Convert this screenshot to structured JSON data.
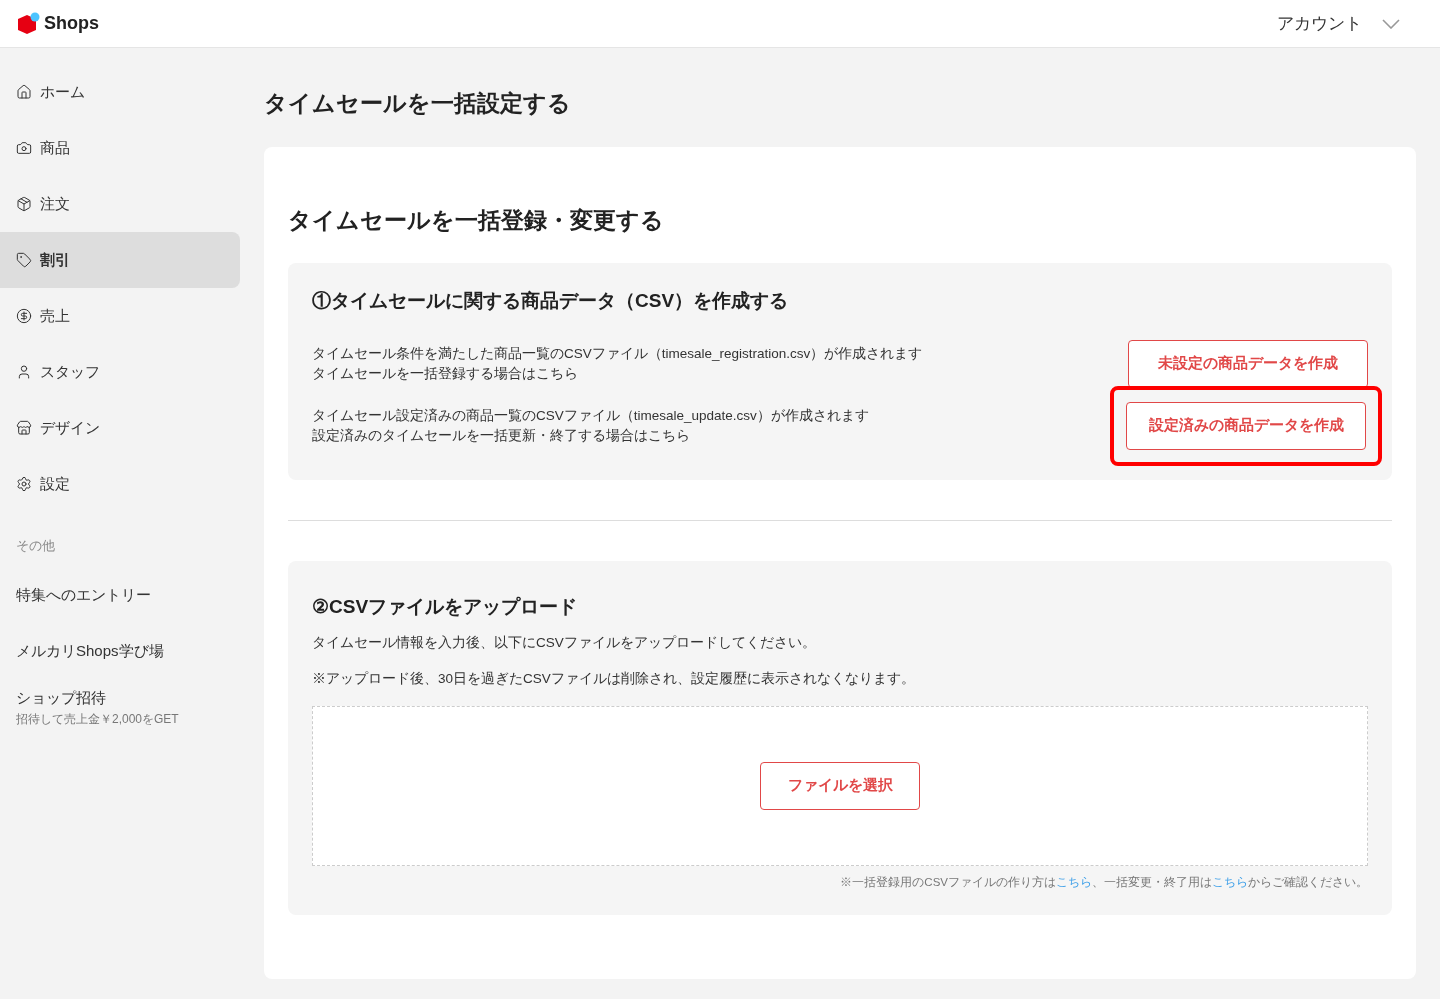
{
  "header": {
    "logo": "Shops",
    "account": "アカウント"
  },
  "sidebar": {
    "items": [
      {
        "label": "ホーム",
        "selected": false
      },
      {
        "label": "商品",
        "selected": false
      },
      {
        "label": "注文",
        "selected": false
      },
      {
        "label": "割引",
        "selected": true
      },
      {
        "label": "売上",
        "selected": false
      },
      {
        "label": "スタッフ",
        "selected": false
      },
      {
        "label": "デザイン",
        "selected": false
      },
      {
        "label": "設定",
        "selected": false
      }
    ],
    "section_label": "その他",
    "other_items": [
      {
        "label": "特集へのエントリー"
      },
      {
        "label": "メルカリShops学び場"
      },
      {
        "label": "ショップ招待",
        "sub": "招待して売上金￥2,000をGET"
      }
    ]
  },
  "page_title": "タイムセールを一括設定する",
  "card": {
    "title": "タイムセールを一括登録・変更する",
    "step1": {
      "title": "①タイムセールに関する商品データ（CSV）を作成する",
      "rows": [
        {
          "lines": [
            "タイムセール条件を満たした商品一覧のCSVファイル（timesale_registration.csv）が作成されます",
            "タイムセールを一括登録する場合はこちら"
          ],
          "button": "未設定の商品データを作成",
          "highlighted": false
        },
        {
          "lines": [
            "タイムセール設定済みの商品一覧のCSVファイル（timesale_update.csv）が作成されます",
            "設定済みのタイムセールを一括更新・終了する場合はこちら"
          ],
          "button": "設定済みの商品データを作成",
          "highlighted": true
        }
      ]
    },
    "step2": {
      "title": "②CSVファイルをアップロード",
      "description": "タイムセール情報を入力後、以下にCSVファイルをアップロードしてください。",
      "note": "※アップロード後、30日を過ぎたCSVファイルは削除され、設定履歴に表示されなくなります。",
      "button": "ファイルを選択",
      "footnote": [
        {
          "kind": "text",
          "text": "※一括登録用のCSVファイルの作り方は"
        },
        {
          "kind": "link",
          "text": "こちら"
        },
        {
          "kind": "text",
          "text": "、一括変更・終了用は"
        },
        {
          "kind": "link",
          "text": "こちら"
        },
        {
          "kind": "text",
          "text": "からご確認ください。"
        }
      ]
    }
  }
}
